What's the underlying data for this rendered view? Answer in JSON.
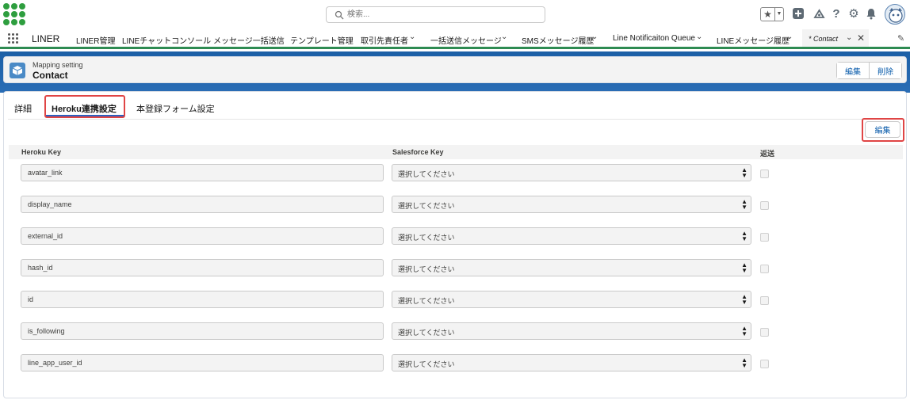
{
  "header": {
    "search_placeholder": "検索..."
  },
  "nav": {
    "app_name": "LINER",
    "items": [
      {
        "label": "LINER管理"
      },
      {
        "label": "LINEチャットコンソール"
      },
      {
        "label": "メッセージ一括送信"
      },
      {
        "label": "テンプレート管理"
      },
      {
        "label": "取引先責任者"
      },
      {
        "label": "一括送信メッセージ"
      },
      {
        "label": "SMSメッセージ履歴"
      },
      {
        "label": "Line Notificaiton Queue"
      },
      {
        "label": "LINEメッセージ履歴"
      }
    ],
    "active_tab": "* Contact"
  },
  "record": {
    "object_type": "Mapping setting",
    "name": "Contact",
    "edit_label": "編集",
    "delete_label": "削除"
  },
  "tabs": {
    "details": "詳細",
    "heroku": "Heroku連携設定",
    "form": "本登録フォーム設定"
  },
  "mapping": {
    "edit_label": "編集",
    "col_heroku": "Heroku Key",
    "col_salesforce": "Salesforce Key",
    "col_return": "返送",
    "rows": [
      {
        "heroku_key": "avatar_link",
        "salesforce_key": "選択してください"
      },
      {
        "heroku_key": "display_name",
        "salesforce_key": "選択してください"
      },
      {
        "heroku_key": "external_id",
        "salesforce_key": "選択してください"
      },
      {
        "heroku_key": "hash_id",
        "salesforce_key": "選択してください"
      },
      {
        "heroku_key": "id",
        "salesforce_key": "選択してください"
      },
      {
        "heroku_key": "is_following",
        "salesforce_key": "選択してください"
      },
      {
        "heroku_key": "line_app_user_id",
        "salesforce_key": "選択してください"
      }
    ]
  },
  "colors": {
    "brand_green": "#2e9e3f",
    "link_blue": "#0b5cab",
    "highlight_red": "#e04545",
    "band_blue": "#1b5fa6"
  }
}
